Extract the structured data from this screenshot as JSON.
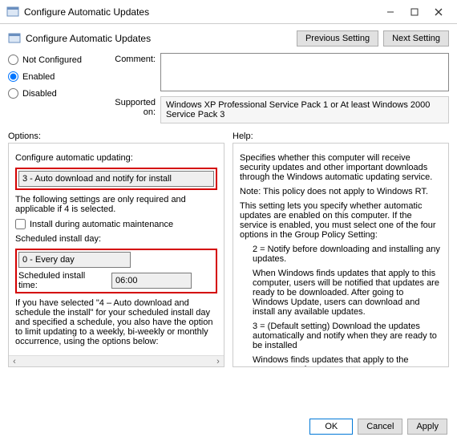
{
  "window": {
    "title": "Configure Automatic Updates"
  },
  "header": {
    "title": "Configure Automatic Updates",
    "prev": "Previous Setting",
    "next": "Next Setting"
  },
  "state": {
    "not_configured": "Not Configured",
    "enabled": "Enabled",
    "disabled": "Disabled"
  },
  "labels": {
    "comment": "Comment:",
    "supported": "Supported on:",
    "options": "Options:",
    "help": "Help:"
  },
  "supported_text": "Windows XP Professional Service Pack 1 or At least Windows 2000 Service Pack 3",
  "options": {
    "cfg_label": "Configure automatic updating:",
    "cfg_value": "3 - Auto download and notify for install",
    "note": "The following settings are only required and applicable if 4 is selected.",
    "maint": "Install during automatic maintenance",
    "day_label": "Scheduled install day:",
    "day_value": "0 - Every day",
    "time_label": "Scheduled install time:",
    "time_value": "06:00",
    "tail": "If you have selected \"4 – Auto download and schedule the install\" for your scheduled install day and specified a schedule, you also have the option to limit updating to a weekly, bi-weekly or monthly occurrence, using the options below:"
  },
  "help": {
    "p1": "Specifies whether this computer will receive security updates and other important downloads through the Windows automatic updating service.",
    "p2": "Note: This policy does not apply to Windows RT.",
    "p3": "This setting lets you specify whether automatic updates are enabled on this computer. If the service is enabled, you must select one of the four options in the Group Policy Setting:",
    "p4": "2 = Notify before downloading and installing any updates.",
    "p5": "When Windows finds updates that apply to this computer, users will be notified that updates are ready to be downloaded. After going to Windows Update, users can download and install any available updates.",
    "p6": "3 = (Default setting) Download the updates automatically and notify when they are ready to be installed",
    "p7": "Windows finds updates that apply to the computer and"
  },
  "footer": {
    "ok": "OK",
    "cancel": "Cancel",
    "apply": "Apply"
  }
}
